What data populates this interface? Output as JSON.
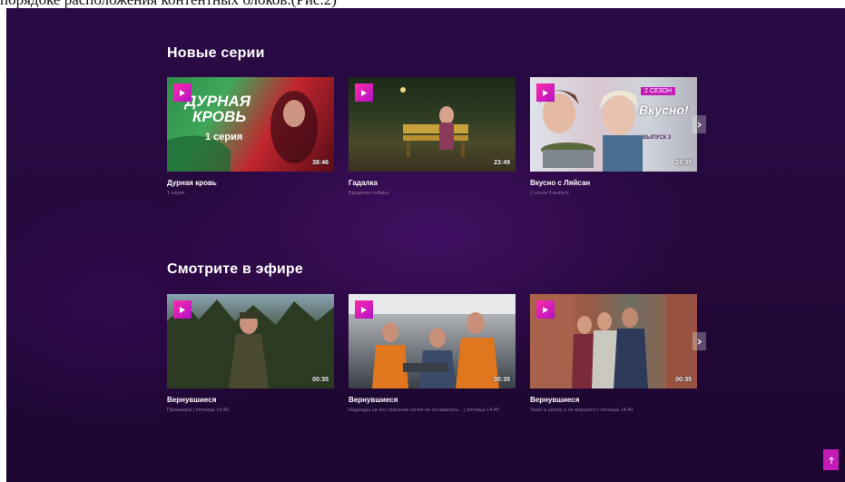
{
  "caption": "порядоке расположения контентных блоков.(Рис.2)",
  "sections": [
    {
      "title": "Новые серии",
      "cards": [
        {
          "title": "Дурная кровь",
          "subtitle": "1 серия",
          "duration": "38:46",
          "overlay_lines": [
            "ДУРНАЯ",
            "КРОВЬ",
            "1 серия"
          ]
        },
        {
          "title": "Гадалка",
          "subtitle": "Бродячая собака",
          "duration": "23:49"
        },
        {
          "title": "Вкусно с Ляйсан",
          "subtitle": "2 сезон 3 выпуск",
          "duration": "24:35",
          "overlay_lines": [
            "2 СЕЗОН",
            "Вкусно!",
            "ВЫПУСК 3"
          ]
        }
      ]
    },
    {
      "title": "Смотрите в эфире",
      "cards": [
        {
          "title": "Вернувшиеся",
          "subtitle": "Премьера! | пятница 14:40",
          "duration": "00:35"
        },
        {
          "title": "Вернувшиеся",
          "subtitle": "Надежды на его спасение почти не оставалось... | пятница 14:40",
          "duration": "00:35"
        },
        {
          "title": "Вернувшиеся",
          "subtitle": "Ушел в школу и не вернулся | пятница 14:40",
          "duration": "00:35"
        }
      ]
    }
  ],
  "icons": {
    "play": "play-icon",
    "next": "chevron-right-icon",
    "scroll_top": "arrow-up-icon"
  },
  "colors": {
    "background": "#240839",
    "accent": "#c41bb6",
    "text": "#ffffff",
    "subtext": "#8b7a9c"
  }
}
